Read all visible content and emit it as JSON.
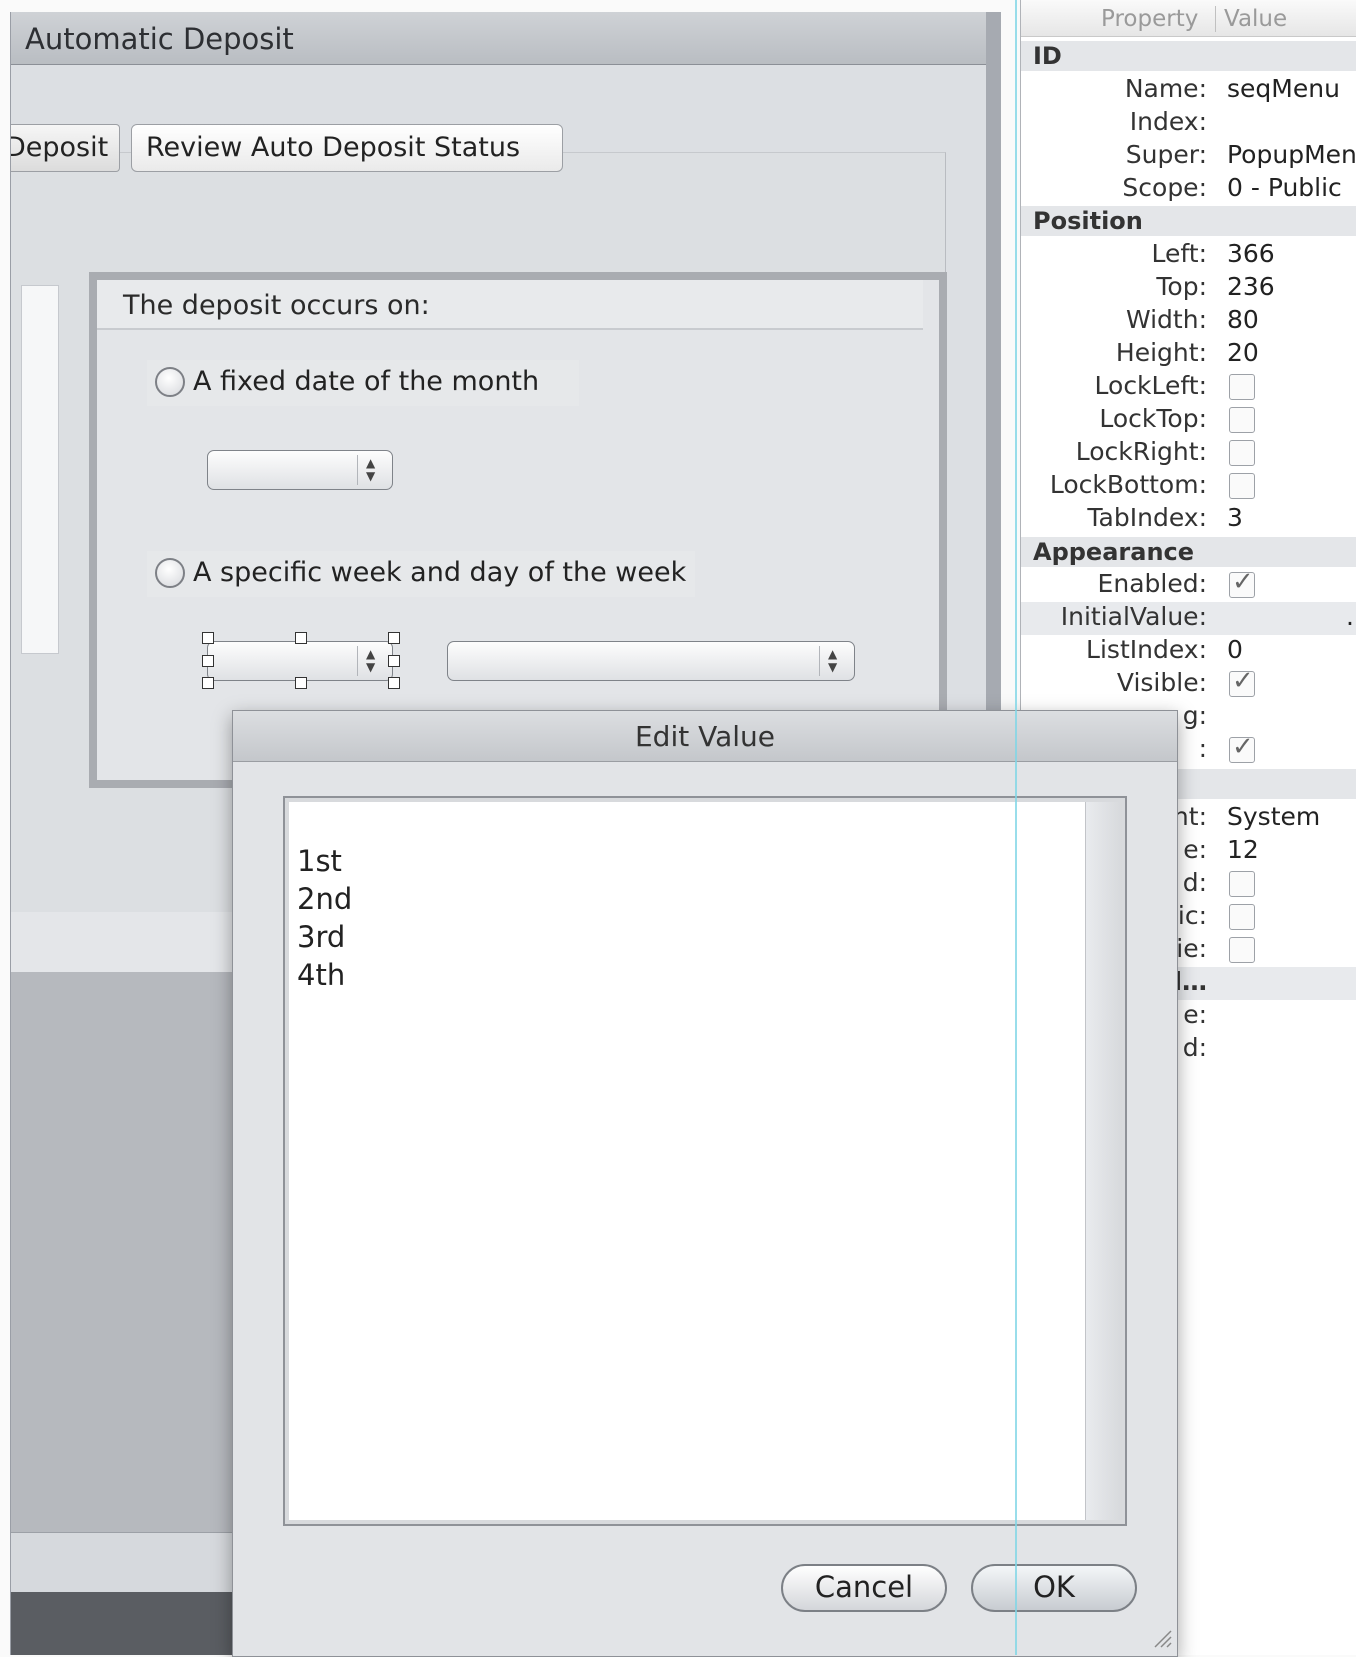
{
  "window": {
    "title": "Automatic Deposit",
    "tabs": [
      {
        "label": "Deposit"
      },
      {
        "label": "Review Auto Deposit Status"
      }
    ],
    "group": {
      "label": "The deposit occurs on:",
      "radio_fixed_label": "A fixed date of the month",
      "radio_week_label": "A specific week and day of the week"
    }
  },
  "inspector": {
    "header": {
      "property": "Property",
      "value": "Value"
    },
    "sections": {
      "id": "ID",
      "position": "Position",
      "appearance": "Appearance"
    },
    "rows": {
      "name": {
        "key": "Name:",
        "value": "seqMenu"
      },
      "index": {
        "key": "Index:",
        "value": ""
      },
      "super": {
        "key": "Super:",
        "value": "PopupMen"
      },
      "scope": {
        "key": "Scope:",
        "value": "0 - Public"
      },
      "left": {
        "key": "Left:",
        "value": "366"
      },
      "top": {
        "key": "Top:",
        "value": "236"
      },
      "width": {
        "key": "Width:",
        "value": "80"
      },
      "height": {
        "key": "Height:",
        "value": "20"
      },
      "lockleft": {
        "key": "LockLeft:"
      },
      "locktop": {
        "key": "LockTop:"
      },
      "lockright": {
        "key": "LockRight:"
      },
      "lockbottom": {
        "key": "LockBottom:"
      },
      "tabindex": {
        "key": "TabIndex:",
        "value": "3"
      },
      "enabled": {
        "key": "Enabled:"
      },
      "initialvalue": {
        "key": "InitialValue:",
        "value": "..."
      },
      "listindex": {
        "key": "ListIndex:",
        "value": "0"
      },
      "visible": {
        "key": "Visible:"
      },
      "partial_g": {
        "key": "g:"
      },
      "partial_e": {
        "key": ":"
      },
      "font": {
        "key": "nt:",
        "value": "System"
      },
      "size": {
        "key": "e:",
        "value": "12"
      },
      "bold": {
        "key": "d:"
      },
      "italic": {
        "key": "ic:"
      },
      "underline": {
        "key": "ie:"
      },
      "advanced": {
        "key": "d…"
      },
      "r1": {
        "key": "e:"
      },
      "r2": {
        "key": "d:"
      }
    },
    "checkmark": "✓"
  },
  "dialog": {
    "title": "Edit Value",
    "lines": [
      "1st",
      "2nd",
      "3rd",
      "4th"
    ],
    "cancel_label": "Cancel",
    "ok_label": "OK"
  }
}
